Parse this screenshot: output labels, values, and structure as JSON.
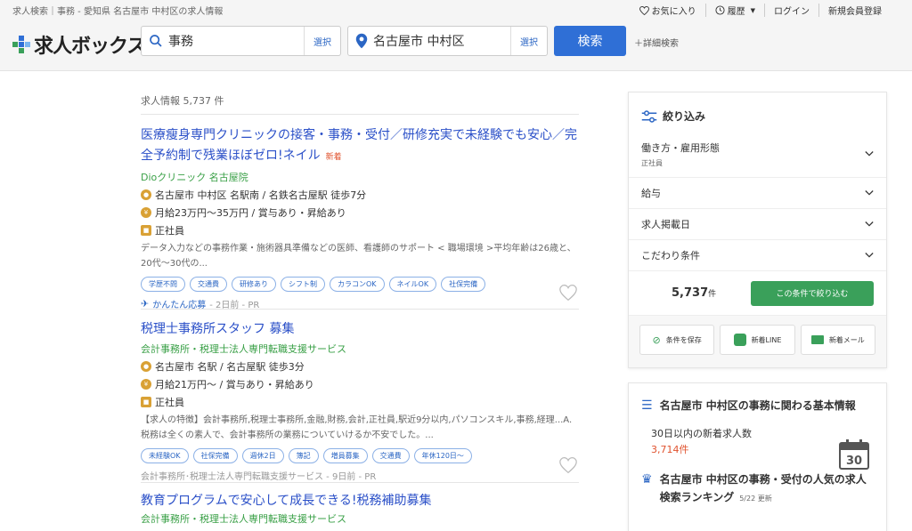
{
  "header": {
    "breadcrumb": "求人検索｜事務 - 愛知県 名古屋市 中村区の求人情報",
    "links": {
      "favorite": "お気に入り",
      "history": "履歴",
      "login": "ログイン",
      "register": "新規会員登録"
    },
    "logo": "求人ボックス",
    "keyword": {
      "value": "事務",
      "select": "選択"
    },
    "location": {
      "value": "名古屋市 中村区",
      "select": "選択"
    },
    "search_button": "検索",
    "detail_search": "＋詳細検索"
  },
  "results": {
    "count": "求人情報 5,737 件",
    "jobs": [
      {
        "title": "医療瘦身専門クリニックの接客・事務・受付／研修充実で未経験でも安心／完全予約制で残業ほぼゼロ!ネイル",
        "new": "新着",
        "company": "Dioクリニック 名古屋院",
        "location": "名古屋市 中村区 名駅南 / 名鉄名古屋駅 徒歩7分",
        "salary": "月給23万円〜35万円 / 賞与あり・昇給あり",
        "type": "正社員",
        "desc": "データ入力などの事務作業・施術器具準備などの医師、看護師のサポート < 職場環境 >平均年齢は26歳と、20代〜30代の...",
        "tags": [
          "学歴不問",
          "交通費",
          "研修あり",
          "シフト制",
          "カラコンOK",
          "ネイルOK",
          "社保完備"
        ],
        "foot_easy": "かんたん応募",
        "foot": "- 2日前 - PR"
      },
      {
        "title": "税理士事務所スタッフ 募集",
        "company": "会計事務所・税理士法人専門転職支援サービス",
        "location": "名古屋市 名駅 / 名古屋駅 徒歩3分",
        "salary": "月給21万円〜 / 賞与あり・昇給あり",
        "type": "正社員",
        "desc": "【求人の特徴】会計事務所,税理士事務所,金融,財務,会計,正社員,駅近9分以内,パソコンスキル,事務,経理...A. 税務は全くの素人で、会計事務所の業務についていけるか不安でした。...",
        "tags": [
          "未経験OK",
          "社保完備",
          "週休2日",
          "簿記",
          "増員募集",
          "交通費",
          "年休120日〜"
        ],
        "foot": "会計事務所･税理士法人専門転職支援サービス - 9日前 - PR"
      },
      {
        "title": "教育プログラムで安心して成長できる!税務補助募集",
        "company": "会計事務所・税理士法人専門転職支援サービス"
      }
    ]
  },
  "sidebar": {
    "filter_title": "絞り込み",
    "filters": [
      {
        "label": "働き方・雇用形態",
        "sub": "正社員"
      },
      {
        "label": "給与"
      },
      {
        "label": "求人掲載日"
      },
      {
        "label": "こだわり条件"
      }
    ],
    "total": "5,737",
    "total_unit": "件",
    "apply_button": "この条件で絞り込む",
    "actions": {
      "save": "条件を保存",
      "line": "新着LINE",
      "mail": "新着メール"
    },
    "info_title": "名古屋市 中村区の事務に関わる基本情報",
    "info_label": "30日以内の新着求人数",
    "info_value": "3,714件",
    "calendar_day": "30",
    "ranking_title": "名古屋市 中村区の事務・受付の人気の求人検索ランキング",
    "ranking_date": "5/22 更新"
  },
  "colors": {
    "link": "#2b50c8",
    "company": "#3aa047",
    "accent": "#2f6fd6",
    "green": "#3aa05a",
    "new": "#e0532f"
  }
}
